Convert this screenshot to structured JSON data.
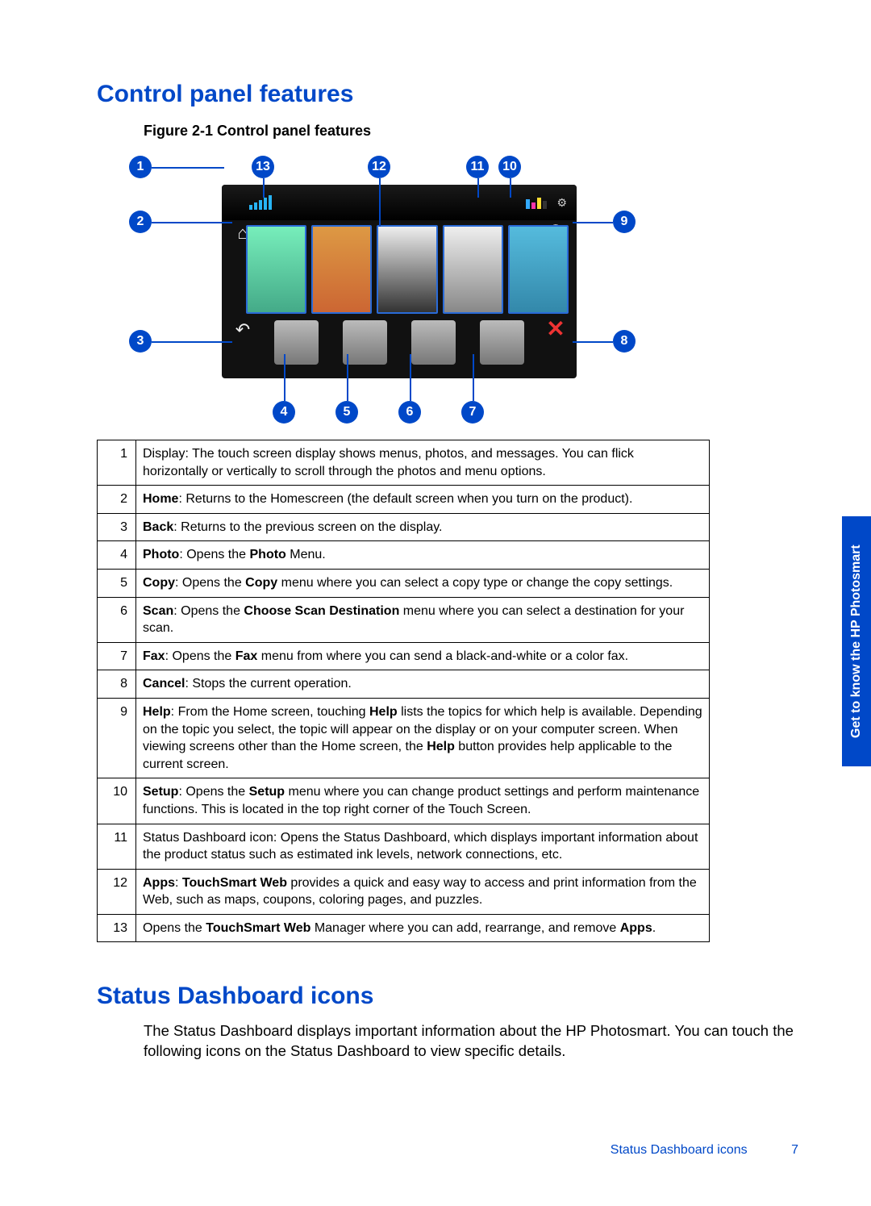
{
  "headings": {
    "control_panel": "Control panel features",
    "status_dashboard": "Status Dashboard icons"
  },
  "figure_caption": "Figure 2-1 Control panel features",
  "callouts": [
    "1",
    "2",
    "3",
    "4",
    "5",
    "6",
    "7",
    "8",
    "9",
    "10",
    "11",
    "12",
    "13"
  ],
  "icon_names": {
    "home": "home-icon",
    "back": "back-icon",
    "help": "help-icon",
    "cancel": "cancel-icon"
  },
  "table_rows": [
    {
      "n": "1",
      "html": "Display: The touch screen display shows menus, photos, and messages. You can flick horizontally or vertically to scroll through the photos and menu options."
    },
    {
      "n": "2",
      "html": "<b>Home</b>: Returns to the Homescreen (the default screen when you turn on the product)."
    },
    {
      "n": "3",
      "html": "<b>Back</b>: Returns to the previous screen on the display."
    },
    {
      "n": "4",
      "html": "<b>Photo</b>: Opens the <b>Photo</b> Menu."
    },
    {
      "n": "5",
      "html": "<b>Copy</b>: Opens the <b>Copy</b> menu where you can select a copy type or change the copy settings."
    },
    {
      "n": "6",
      "html": "<b>Scan</b>: Opens the <b>Choose Scan Destination</b> menu where you can select a destination for your scan."
    },
    {
      "n": "7",
      "html": "<b>Fax</b>: Opens the <b>Fax</b> menu from where you can send a black-and-white or a color fax."
    },
    {
      "n": "8",
      "html": "<b>Cancel</b>: Stops the current operation."
    },
    {
      "n": "9",
      "html": "<b>Help</b>: From the Home screen, touching <b>Help</b> lists the topics for which help is available. Depending on the topic you select, the topic will appear on the display or on your computer screen. When viewing screens other than the Home screen, the <b>Help</b> button provides help applicable to the current screen."
    },
    {
      "n": "10",
      "html": "<b>Setup</b>: Opens the <b>Setup</b> menu where you can change product settings and perform maintenance functions. This is located in the top right corner of the Touch Screen."
    },
    {
      "n": "11",
      "html": "Status Dashboard icon: Opens the Status Dashboard, which displays important information about the product status such as estimated ink levels, network connections, etc."
    },
    {
      "n": "12",
      "html": "<b>Apps</b>: <b>TouchSmart Web</b> provides a quick and easy way to access and print information from the Web, such as maps, coupons, coloring pages, and puzzles."
    },
    {
      "n": "13",
      "html": "Opens the <b>TouchSmart Web</b> Manager where you can add, rearrange, and remove <b>Apps</b>."
    }
  ],
  "status_intro": "The Status Dashboard displays important information about the HP Photosmart. You can touch the following icons on the Status Dashboard to view specific details.",
  "side_tab": "Get to know the HP Photosmart",
  "footer": {
    "title": "Status Dashboard icons",
    "page": "7"
  }
}
